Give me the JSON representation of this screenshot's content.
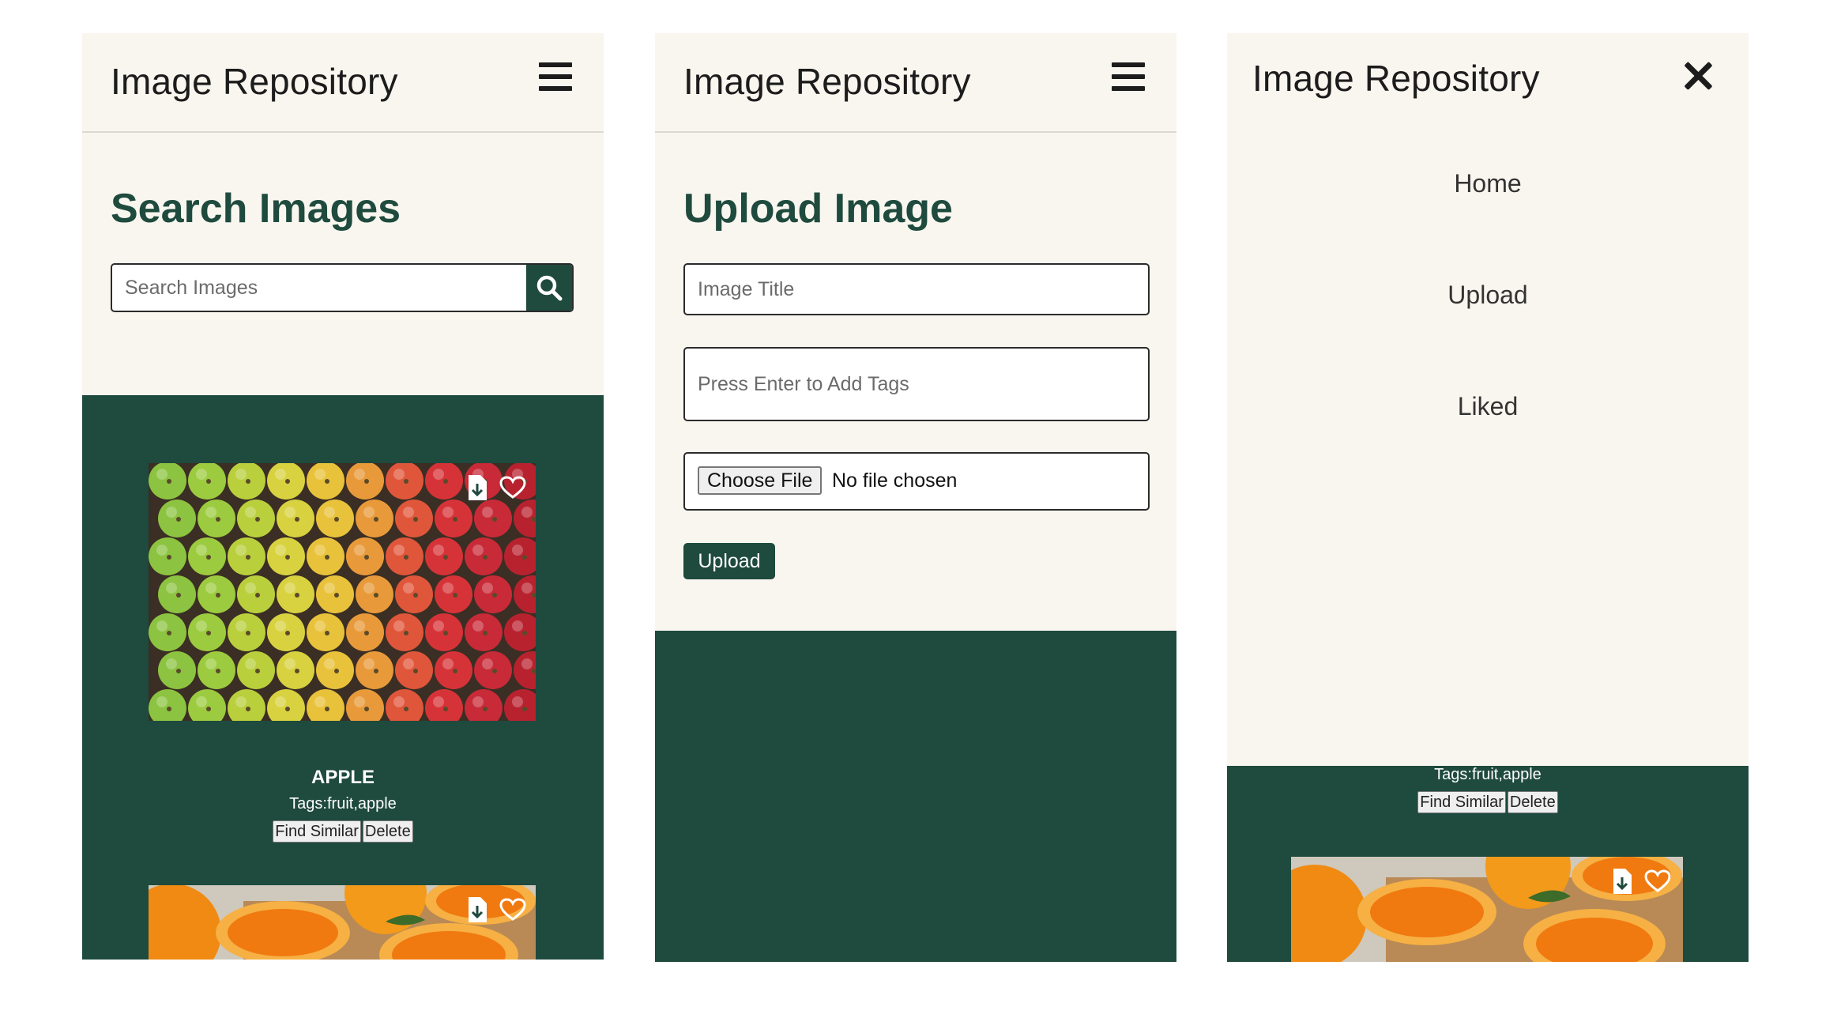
{
  "colors": {
    "brand": "#1f4a3e",
    "surface": "#f9f6ef",
    "text": "#1c1c1c"
  },
  "app_title": "Image Repository",
  "search_screen": {
    "heading": "Search Images",
    "search_placeholder": "Search Images",
    "images": [
      {
        "title": "APPLE",
        "tags": "Tags:fruit,apple",
        "find_similar": "Find Similar",
        "delete": "Delete"
      },
      {
        "title": "",
        "tags": "",
        "find_similar": "",
        "delete": ""
      }
    ]
  },
  "upload_screen": {
    "heading": "Upload Image",
    "title_placeholder": "Image Title",
    "tags_placeholder": "Press Enter to Add Tags",
    "choose_file": "Choose File",
    "no_file": "No file chosen",
    "upload_button": "Upload"
  },
  "menu_screen": {
    "nav": [
      {
        "label": "Home"
      },
      {
        "label": "Upload"
      },
      {
        "label": "Liked"
      }
    ],
    "visible_tags": "Tags:fruit,apple",
    "find_similar": "Find Similar",
    "delete": "Delete"
  },
  "icons": [
    "hamburger-menu-icon",
    "search-icon",
    "download-icon",
    "heart-icon",
    "close-icon"
  ]
}
